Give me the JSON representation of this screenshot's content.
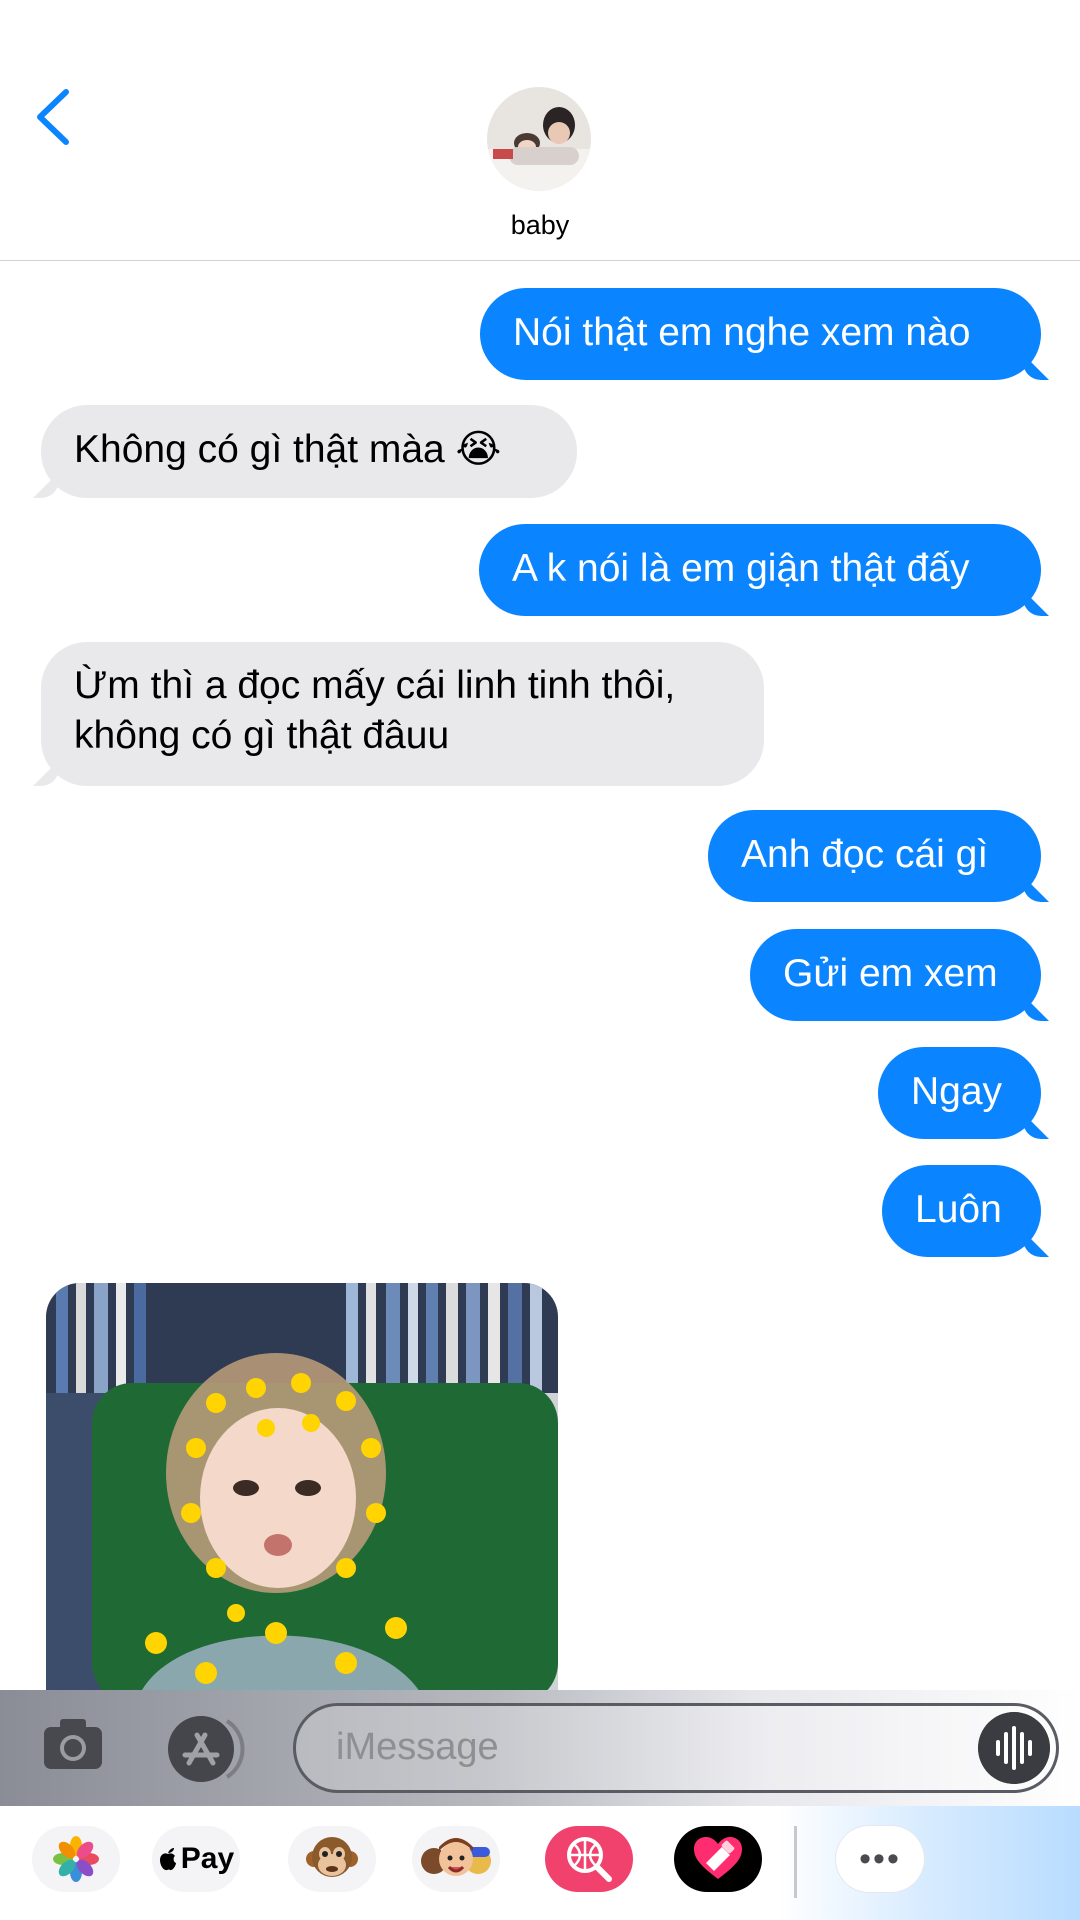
{
  "header": {
    "contact_name": "baby"
  },
  "messages": [
    {
      "from": "me",
      "text": "Nói thật em nghe xem nào"
    },
    {
      "from": "them",
      "text": "Không có gì thật màa 😭"
    },
    {
      "from": "me",
      "text": "A k nói là em giận thật đấy"
    },
    {
      "from": "them",
      "line1": "Ừm thì a đọc mấy cái linh tinh thôi,",
      "line2": "không có gì thật đâuu"
    },
    {
      "from": "me",
      "text": "Anh đọc cái gì"
    },
    {
      "from": "me",
      "text": "Gửi em xem"
    },
    {
      "from": "me",
      "text": "Ngay"
    },
    {
      "from": "me",
      "text": "Luôn"
    }
  ],
  "compose": {
    "placeholder": "iMessage"
  },
  "app_drawer": {
    "apple_pay_label": "Pay",
    "more_label": "•••"
  },
  "colors": {
    "sent_bubble": "#0a84ff",
    "received_bubble": "#e9e9eb",
    "accent": "#0a84ff"
  },
  "icons": [
    "battery-icon",
    "back-chevron-icon",
    "camera-icon",
    "app-store-icon",
    "audio-waveform-icon",
    "photos-app-icon",
    "apple-pay-icon",
    "animoji-monkey-icon",
    "memoji-icon",
    "images-search-icon",
    "digital-touch-icon",
    "more-icon"
  ]
}
